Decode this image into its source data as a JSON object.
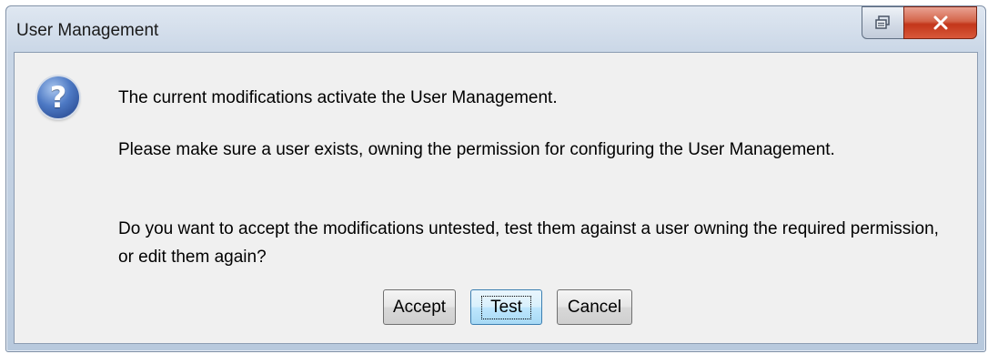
{
  "window": {
    "title": "User Management",
    "restore_icon": "restore-icon",
    "close_icon": "close-icon",
    "close_glyph": "x"
  },
  "dialog": {
    "icon": "question-icon",
    "icon_glyph": "?",
    "messages": [
      "The current modifications activate the User Management.",
      "Please make sure a user exists, owning the permission for configuring the User Management.",
      "Do you want to accept the modifications untested, test them against a user owning the required permission, or edit them again?"
    ]
  },
  "buttons": {
    "accept": "Accept",
    "test": "Test",
    "cancel": "Cancel",
    "default": "Test"
  },
  "colors": {
    "close_button": "#c3361a",
    "question_icon": "#4d79c4",
    "focused_button": "#3c7fb1"
  }
}
